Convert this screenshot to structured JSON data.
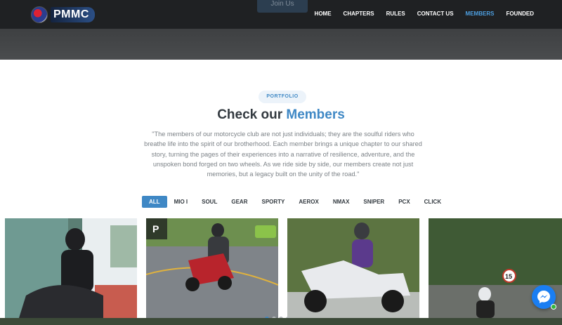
{
  "header": {
    "logo_text": "PMMC",
    "join_label": "Join Us",
    "nav": [
      {
        "label": "HOME"
      },
      {
        "label": "CHAPTERS"
      },
      {
        "label": "RULES"
      },
      {
        "label": "CONTACT US"
      },
      {
        "label": "MEMBERS",
        "active": true
      },
      {
        "label": "FOUNDED"
      }
    ]
  },
  "portfolio": {
    "badge": "PORTFOLIO",
    "title_prefix": "Check our",
    "title_accent": "Members",
    "description": "\"The members of our motorcycle club are not just individuals; they are the soulful riders who breathe life into the spirit of our brotherhood. Each member brings a unique chapter to our shared story, turning the pages of their experiences into a narrative of resilience, adventure, and the unspoken bond forged on two wheels. As we ride side by side, our members create not just memories, but a legacy built on the unity of the road.\"",
    "filters": [
      {
        "label": "ALL",
        "active": true
      },
      {
        "label": "MIO I"
      },
      {
        "label": "SOUL"
      },
      {
        "label": "GEAR"
      },
      {
        "label": "SPORTY"
      },
      {
        "label": "AEROX"
      },
      {
        "label": "NMAX"
      },
      {
        "label": "SNIPER"
      },
      {
        "label": "PCX"
      },
      {
        "label": "CLICK"
      }
    ]
  },
  "cards": [
    {
      "name": "rider-photo-1"
    },
    {
      "name": "rider-photo-2"
    },
    {
      "name": "rider-photo-3"
    },
    {
      "name": "rider-photo-4"
    }
  ],
  "colors": {
    "accent": "#3f88c5",
    "header_bg": "#1f2123",
    "messenger": "#1a7ef2"
  }
}
